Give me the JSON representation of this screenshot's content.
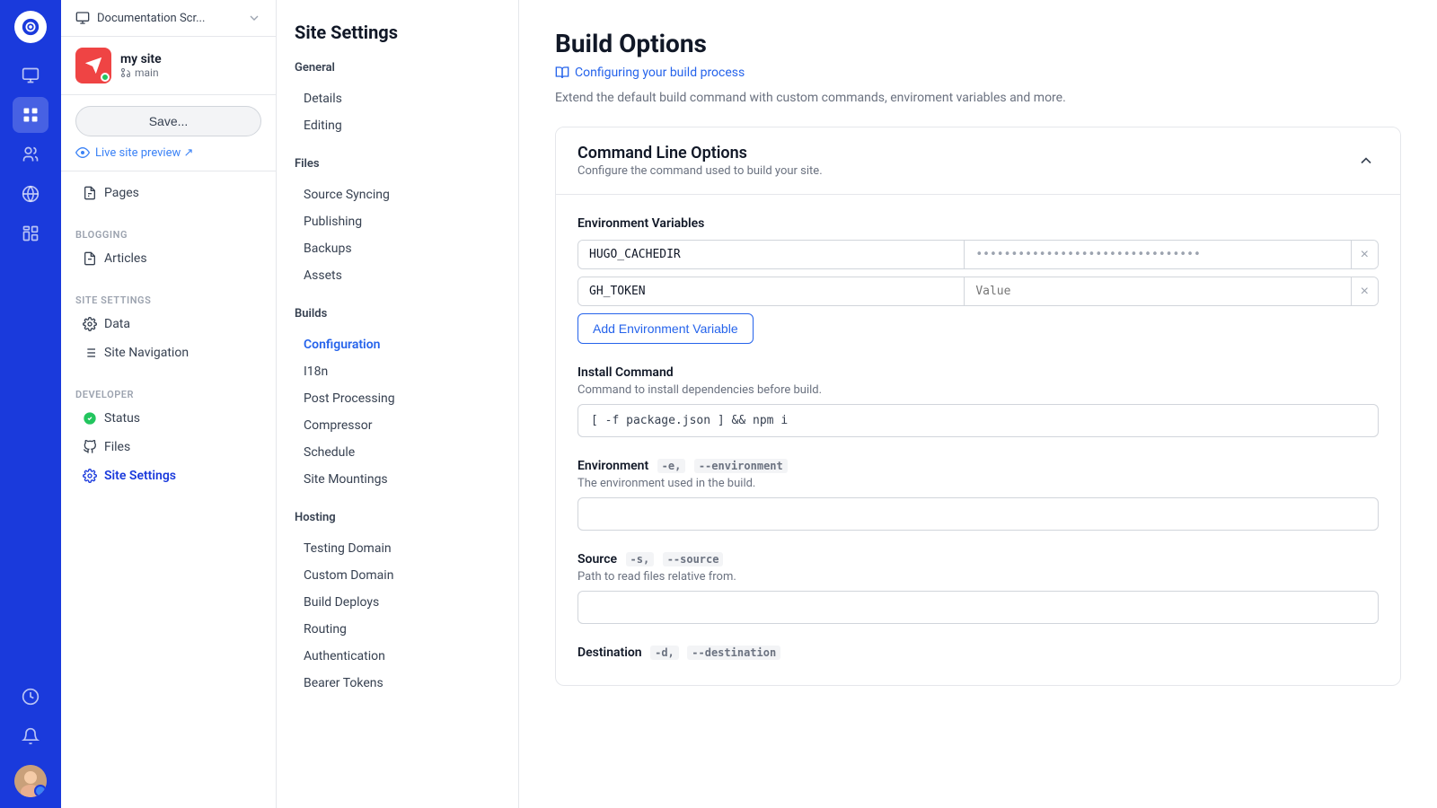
{
  "app": {
    "logo_text": "◎",
    "workspace_label": "Documentation Scr..."
  },
  "site": {
    "name": "my site",
    "branch": "main",
    "save_label": "Save..."
  },
  "live_preview": {
    "label": "Live site preview ↗"
  },
  "left_nav": {
    "sections": [
      {
        "label": "",
        "items": [
          {
            "id": "pages",
            "icon": "doc-icon",
            "label": "Pages"
          }
        ]
      },
      {
        "label": "Blogging",
        "items": [
          {
            "id": "articles",
            "icon": "doc-icon",
            "label": "Articles"
          }
        ]
      },
      {
        "label": "Site Settings",
        "items": [
          {
            "id": "data",
            "icon": "gear-icon",
            "label": "Data"
          },
          {
            "id": "site-navigation",
            "icon": "list-icon",
            "label": "Site Navigation"
          }
        ]
      },
      {
        "label": "Developer",
        "items": [
          {
            "id": "status",
            "icon": "check-icon",
            "label": "Status"
          },
          {
            "id": "files",
            "icon": "github-icon",
            "label": "Files"
          },
          {
            "id": "site-settings",
            "icon": "gear-icon",
            "label": "Site Settings",
            "active": true
          }
        ]
      }
    ]
  },
  "settings_panel": {
    "title": "Site Settings",
    "groups": [
      {
        "label": "General",
        "items": [
          {
            "id": "details",
            "label": "Details"
          },
          {
            "id": "editing",
            "label": "Editing"
          }
        ]
      },
      {
        "label": "Files",
        "items": [
          {
            "id": "source-syncing",
            "label": "Source Syncing"
          },
          {
            "id": "publishing",
            "label": "Publishing"
          },
          {
            "id": "backups",
            "label": "Backups"
          },
          {
            "id": "assets",
            "label": "Assets"
          }
        ]
      },
      {
        "label": "Builds",
        "items": [
          {
            "id": "configuration",
            "label": "Configuration",
            "active": true
          },
          {
            "id": "i18n",
            "label": "I18n"
          },
          {
            "id": "post-processing",
            "label": "Post Processing"
          },
          {
            "id": "compressor",
            "label": "Compressor"
          },
          {
            "id": "schedule",
            "label": "Schedule"
          },
          {
            "id": "site-mountings",
            "label": "Site Mountings"
          }
        ]
      },
      {
        "label": "Hosting",
        "items": [
          {
            "id": "testing-domain",
            "label": "Testing Domain"
          },
          {
            "id": "custom-domain",
            "label": "Custom Domain"
          },
          {
            "id": "build-deploys",
            "label": "Build Deploys"
          },
          {
            "id": "routing",
            "label": "Routing"
          },
          {
            "id": "authentication",
            "label": "Authentication"
          },
          {
            "id": "bearer-tokens",
            "label": "Bearer Tokens"
          }
        ]
      }
    ]
  },
  "main": {
    "title": "Build Options",
    "link_text": "Configuring your build process",
    "subtitle": "Extend the default build command with custom commands, enviroment variables and more.",
    "card": {
      "title": "Command Line Options",
      "subtitle": "Configure the command used to build your site.",
      "env_vars_label": "Environment Variables",
      "env_vars": [
        {
          "key": "HUGO_CACHEDIR",
          "value": "••••••••••••••••••••••••••••••••"
        },
        {
          "key": "GH_TOKEN",
          "value": "Value"
        }
      ],
      "add_env_btn": "Add Environment Variable",
      "install_command_label": "Install Command",
      "install_command_meta": "",
      "install_command_desc": "Command to install dependencies before build.",
      "install_command_value": "[ -f package.json ] && npm i",
      "environment_label": "Environment",
      "environment_meta1": "-e,",
      "environment_meta2": "--environment",
      "environment_desc": "The environment used in the build.",
      "environment_value": "",
      "source_label": "Source",
      "source_meta1": "-s,",
      "source_meta2": "--source",
      "source_desc": "Path to read files relative from.",
      "source_value": "",
      "destination_label": "Destination",
      "destination_meta1": "-d,",
      "destination_meta2": "--destination"
    }
  }
}
